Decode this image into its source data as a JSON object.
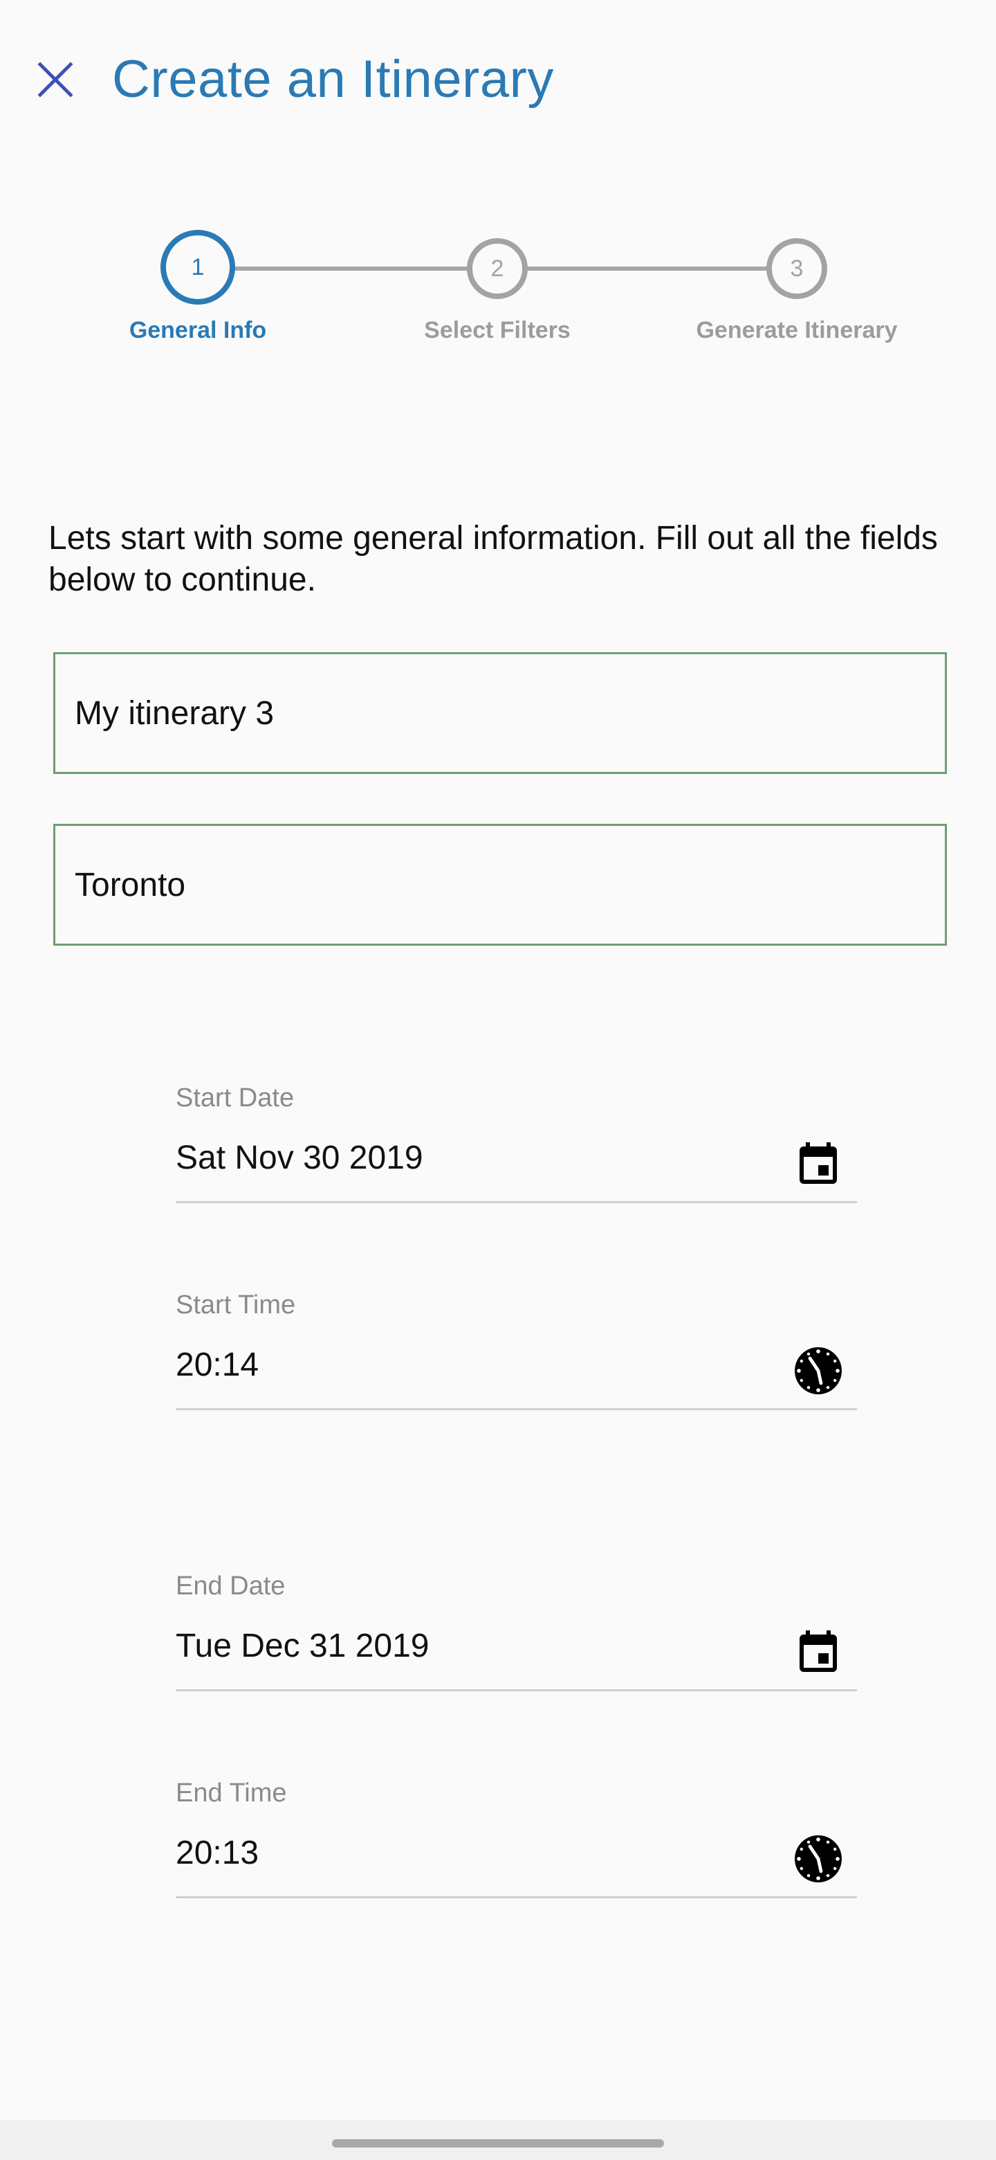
{
  "header": {
    "title": "Create an Itinerary",
    "close_icon": "close-icon"
  },
  "stepper": {
    "steps": [
      {
        "number": "1",
        "label": "General Info",
        "active": true
      },
      {
        "number": "2",
        "label": "Select Filters",
        "active": false
      },
      {
        "number": "3",
        "label": "Generate Itinerary",
        "active": false
      }
    ]
  },
  "intro_text": "Lets start with some general information. Fill out all the fields below to continue.",
  "form": {
    "itinerary_name": "My itinerary 3",
    "location": "Toronto",
    "start_date": {
      "label": "Start Date",
      "value": "Sat Nov 30 2019",
      "icon": "calendar-icon"
    },
    "start_time": {
      "label": "Start Time",
      "value": "20:14",
      "icon": "clock-icon"
    },
    "end_date": {
      "label": "End Date",
      "value": "Tue Dec 31 2019",
      "icon": "calendar-icon"
    },
    "end_time": {
      "label": "End Time",
      "value": "20:13",
      "icon": "clock-icon"
    }
  },
  "colors": {
    "accent": "#2a7ab5",
    "close_icon": "#3f51b5",
    "field_border": "#6f9e73",
    "inactive_step": "#a3a3a3"
  }
}
